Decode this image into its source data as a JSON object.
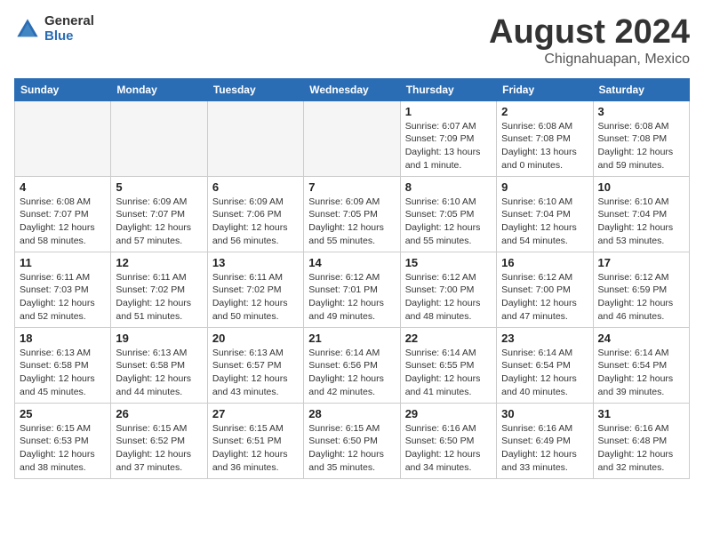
{
  "header": {
    "logo_general": "General",
    "logo_blue": "Blue",
    "main_title": "August 2024",
    "subtitle": "Chignahuapan, Mexico"
  },
  "calendar": {
    "days_of_week": [
      "Sunday",
      "Monday",
      "Tuesday",
      "Wednesday",
      "Thursday",
      "Friday",
      "Saturday"
    ],
    "weeks": [
      [
        {
          "day": "",
          "info": ""
        },
        {
          "day": "",
          "info": ""
        },
        {
          "day": "",
          "info": ""
        },
        {
          "day": "",
          "info": ""
        },
        {
          "day": "1",
          "info": "Sunrise: 6:07 AM\nSunset: 7:09 PM\nDaylight: 13 hours\nand 1 minute."
        },
        {
          "day": "2",
          "info": "Sunrise: 6:08 AM\nSunset: 7:08 PM\nDaylight: 13 hours\nand 0 minutes."
        },
        {
          "day": "3",
          "info": "Sunrise: 6:08 AM\nSunset: 7:08 PM\nDaylight: 12 hours\nand 59 minutes."
        }
      ],
      [
        {
          "day": "4",
          "info": "Sunrise: 6:08 AM\nSunset: 7:07 PM\nDaylight: 12 hours\nand 58 minutes."
        },
        {
          "day": "5",
          "info": "Sunrise: 6:09 AM\nSunset: 7:07 PM\nDaylight: 12 hours\nand 57 minutes."
        },
        {
          "day": "6",
          "info": "Sunrise: 6:09 AM\nSunset: 7:06 PM\nDaylight: 12 hours\nand 56 minutes."
        },
        {
          "day": "7",
          "info": "Sunrise: 6:09 AM\nSunset: 7:05 PM\nDaylight: 12 hours\nand 55 minutes."
        },
        {
          "day": "8",
          "info": "Sunrise: 6:10 AM\nSunset: 7:05 PM\nDaylight: 12 hours\nand 55 minutes."
        },
        {
          "day": "9",
          "info": "Sunrise: 6:10 AM\nSunset: 7:04 PM\nDaylight: 12 hours\nand 54 minutes."
        },
        {
          "day": "10",
          "info": "Sunrise: 6:10 AM\nSunset: 7:04 PM\nDaylight: 12 hours\nand 53 minutes."
        }
      ],
      [
        {
          "day": "11",
          "info": "Sunrise: 6:11 AM\nSunset: 7:03 PM\nDaylight: 12 hours\nand 52 minutes."
        },
        {
          "day": "12",
          "info": "Sunrise: 6:11 AM\nSunset: 7:02 PM\nDaylight: 12 hours\nand 51 minutes."
        },
        {
          "day": "13",
          "info": "Sunrise: 6:11 AM\nSunset: 7:02 PM\nDaylight: 12 hours\nand 50 minutes."
        },
        {
          "day": "14",
          "info": "Sunrise: 6:12 AM\nSunset: 7:01 PM\nDaylight: 12 hours\nand 49 minutes."
        },
        {
          "day": "15",
          "info": "Sunrise: 6:12 AM\nSunset: 7:00 PM\nDaylight: 12 hours\nand 48 minutes."
        },
        {
          "day": "16",
          "info": "Sunrise: 6:12 AM\nSunset: 7:00 PM\nDaylight: 12 hours\nand 47 minutes."
        },
        {
          "day": "17",
          "info": "Sunrise: 6:12 AM\nSunset: 6:59 PM\nDaylight: 12 hours\nand 46 minutes."
        }
      ],
      [
        {
          "day": "18",
          "info": "Sunrise: 6:13 AM\nSunset: 6:58 PM\nDaylight: 12 hours\nand 45 minutes."
        },
        {
          "day": "19",
          "info": "Sunrise: 6:13 AM\nSunset: 6:58 PM\nDaylight: 12 hours\nand 44 minutes."
        },
        {
          "day": "20",
          "info": "Sunrise: 6:13 AM\nSunset: 6:57 PM\nDaylight: 12 hours\nand 43 minutes."
        },
        {
          "day": "21",
          "info": "Sunrise: 6:14 AM\nSunset: 6:56 PM\nDaylight: 12 hours\nand 42 minutes."
        },
        {
          "day": "22",
          "info": "Sunrise: 6:14 AM\nSunset: 6:55 PM\nDaylight: 12 hours\nand 41 minutes."
        },
        {
          "day": "23",
          "info": "Sunrise: 6:14 AM\nSunset: 6:54 PM\nDaylight: 12 hours\nand 40 minutes."
        },
        {
          "day": "24",
          "info": "Sunrise: 6:14 AM\nSunset: 6:54 PM\nDaylight: 12 hours\nand 39 minutes."
        }
      ],
      [
        {
          "day": "25",
          "info": "Sunrise: 6:15 AM\nSunset: 6:53 PM\nDaylight: 12 hours\nand 38 minutes."
        },
        {
          "day": "26",
          "info": "Sunrise: 6:15 AM\nSunset: 6:52 PM\nDaylight: 12 hours\nand 37 minutes."
        },
        {
          "day": "27",
          "info": "Sunrise: 6:15 AM\nSunset: 6:51 PM\nDaylight: 12 hours\nand 36 minutes."
        },
        {
          "day": "28",
          "info": "Sunrise: 6:15 AM\nSunset: 6:50 PM\nDaylight: 12 hours\nand 35 minutes."
        },
        {
          "day": "29",
          "info": "Sunrise: 6:16 AM\nSunset: 6:50 PM\nDaylight: 12 hours\nand 34 minutes."
        },
        {
          "day": "30",
          "info": "Sunrise: 6:16 AM\nSunset: 6:49 PM\nDaylight: 12 hours\nand 33 minutes."
        },
        {
          "day": "31",
          "info": "Sunrise: 6:16 AM\nSunset: 6:48 PM\nDaylight: 12 hours\nand 32 minutes."
        }
      ]
    ]
  }
}
